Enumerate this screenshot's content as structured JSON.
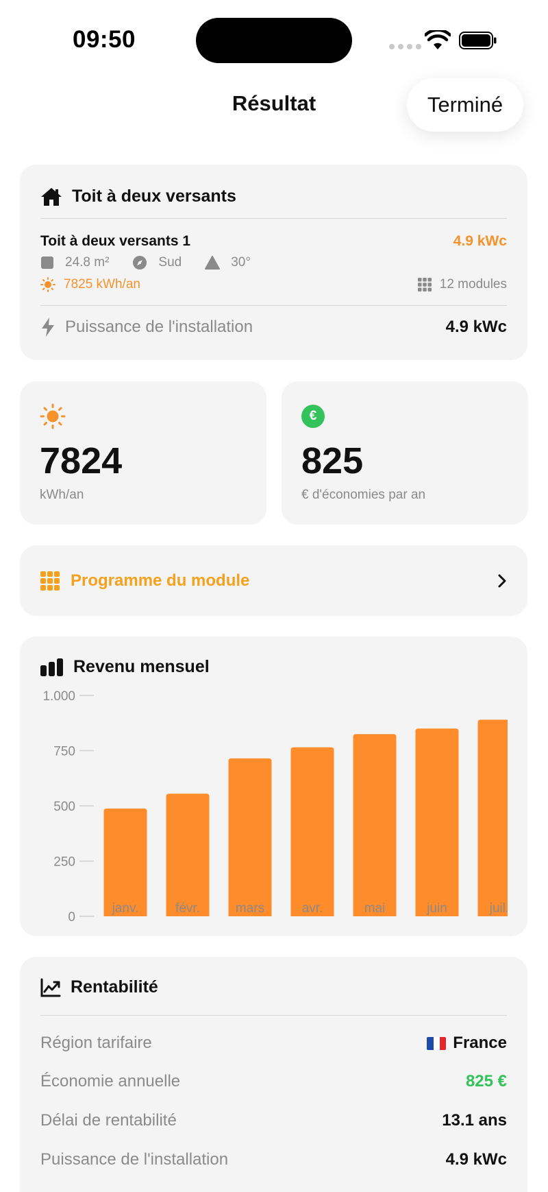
{
  "status_bar": {
    "time": "09:50"
  },
  "nav": {
    "title": "Résultat",
    "done_label": "Terminé"
  },
  "roof_card": {
    "title": "Toit à deux versants",
    "roof_name": "Toit à deux versants 1",
    "roof_power": "4.9 kWc",
    "area": "24.8 m²",
    "orientation": "Sud",
    "tilt": "30°",
    "yield": "7825 kWh/an",
    "modules": "12 modules",
    "install_label": "Puissance de l'installation",
    "install_value": "4.9 kWc"
  },
  "stats": {
    "production_value": "7824",
    "production_unit": "kWh/an",
    "savings_value": "825",
    "savings_unit": "€ d'économies par an",
    "euro_symbol": "€"
  },
  "program": {
    "label": "Programme du module"
  },
  "chart_card": {
    "title": "Revenu mensuel"
  },
  "chart_data": {
    "type": "bar",
    "title": "Revenu mensuel",
    "categories": [
      "janv.",
      "févr.",
      "mars",
      "avr.",
      "mai",
      "juin",
      "juil."
    ],
    "values": [
      488,
      555,
      715,
      765,
      825,
      850,
      890
    ],
    "ylim": [
      0,
      1000
    ],
    "yticks": [
      0,
      250,
      500,
      750,
      1000
    ],
    "ytick_labels": [
      "0",
      "250",
      "500",
      "750",
      "1.000"
    ],
    "grid": false,
    "bar_color": "#ff8c2a"
  },
  "rent_card": {
    "title": "Rentabilité",
    "rows": [
      {
        "label": "Région tarifaire",
        "value": "France"
      },
      {
        "label": "Économie annuelle",
        "value": "825 €"
      },
      {
        "label": "Délai de rentabilité",
        "value": "13.1 ans"
      },
      {
        "label": "Puissance de l'installation",
        "value": "4.9 kWc"
      }
    ]
  },
  "colors": {
    "accent_orange": "#f5922b",
    "green": "#34c25a",
    "program_orange": "#f5a11e"
  }
}
